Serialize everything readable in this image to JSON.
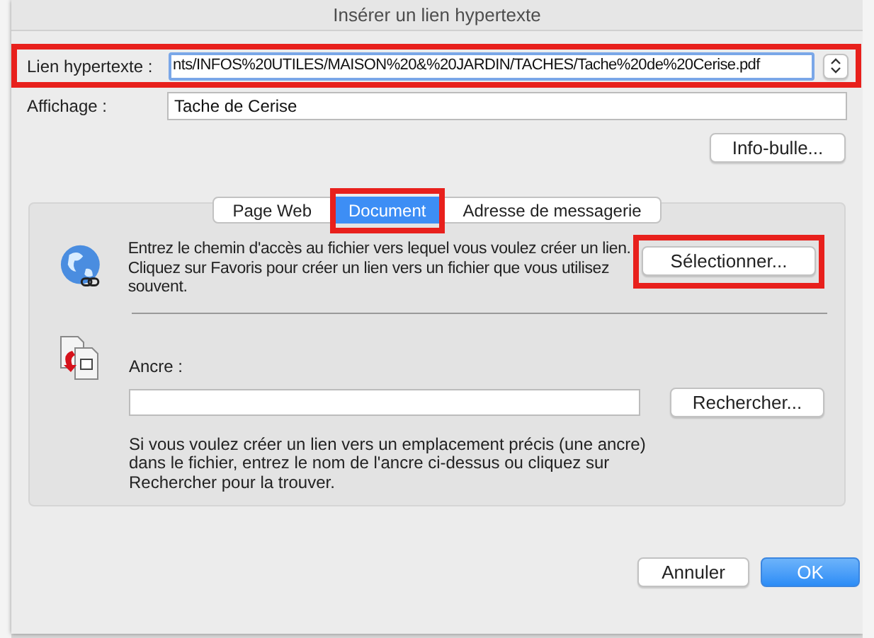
{
  "window": {
    "title": "Insérer un lien hypertexte"
  },
  "hyperlink": {
    "label": "Lien hypertexte :",
    "value": "nts/INFOS%20UTILES/MAISON%20&%20JARDIN/TACHES/Tache%20de%20Cerise.pdf",
    "highlighted": true
  },
  "display": {
    "label": "Affichage :",
    "value": "Tache de Cerise"
  },
  "tooltip_button": {
    "label": "Info-bulle..."
  },
  "tabs": [
    {
      "label": "Page Web",
      "selected": false,
      "highlighted": false
    },
    {
      "label": "Document",
      "selected": true,
      "highlighted": true
    },
    {
      "label": "Adresse de messagerie",
      "selected": false,
      "highlighted": false
    }
  ],
  "document": {
    "description": "Entrez le chemin d'accès au fichier vers lequel vous voulez créer un lien. Cliquez sur Favoris pour créer un lien vers un fichier que vous utilisez souvent.",
    "select_button": {
      "label": "Sélectionner...",
      "highlighted": true
    },
    "anchor_label": "Ancre :",
    "search_button": {
      "label": "Rechercher..."
    },
    "anchor_help": "Si vous voulez créer un lien vers un emplacement précis (une ancre) dans le fichier, entrez le nom de l'ancre ci-dessus ou cliquez sur Rechercher pour la trouver."
  },
  "buttons": [
    {
      "label": "Annuler",
      "kind": "secondary"
    },
    {
      "label": "OK",
      "kind": "primary"
    }
  ]
}
